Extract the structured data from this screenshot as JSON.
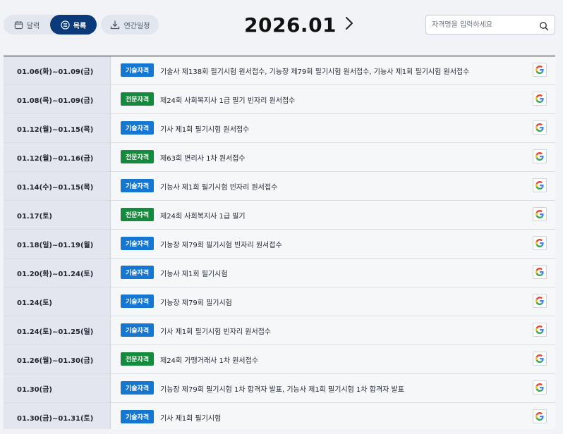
{
  "toolbar": {
    "calendar_label": "달력",
    "list_label": "목록",
    "yearly_label": "연간일정"
  },
  "header": {
    "month": "2026.01"
  },
  "search": {
    "placeholder": "자격명을 입력하세요",
    "value": ""
  },
  "colors": {
    "tech_badge": "#1677d2",
    "pro_badge": "#148a3c",
    "active_toggle": "#0b3a7a"
  },
  "rows": [
    {
      "date": "01.06(화)~01.09(금)",
      "badge": "기술자격",
      "kind": "tech",
      "title": "기술사 제138회 필기시험 원서접수, 기능장 제79회 필기시험 원서접수, 기능사 제1회 필기시험 원서접수",
      "action_icon": "google-g-icon"
    },
    {
      "date": "01.08(목)~01.09(금)",
      "badge": "전문자격",
      "kind": "pro",
      "title": "제24회 사회복지사 1급 필기 빈자리 원서접수",
      "action_icon": "google-g-icon"
    },
    {
      "date": "01.12(월)~01.15(목)",
      "badge": "기술자격",
      "kind": "tech",
      "title": "기사 제1회 필기시험 원서접수",
      "action_icon": "google-g-icon"
    },
    {
      "date": "01.12(월)~01.16(금)",
      "badge": "전문자격",
      "kind": "pro",
      "title": "제63회 변리사 1차 원서접수",
      "action_icon": "google-g-icon"
    },
    {
      "date": "01.14(수)~01.15(목)",
      "badge": "기술자격",
      "kind": "tech",
      "title": "기능사 제1회 필기시험 빈자리 원서접수",
      "action_icon": "google-g-icon"
    },
    {
      "date": "01.17(토)",
      "badge": "전문자격",
      "kind": "pro",
      "title": "제24회 사회복지사 1급 필기",
      "action_icon": "google-g-icon"
    },
    {
      "date": "01.18(일)~01.19(월)",
      "badge": "기술자격",
      "kind": "tech",
      "title": "기능장 제79회 필기시험 빈자리 원서접수",
      "action_icon": "google-g-icon"
    },
    {
      "date": "01.20(화)~01.24(토)",
      "badge": "기술자격",
      "kind": "tech",
      "title": "기능사 제1회 필기시험",
      "action_icon": "google-g-icon"
    },
    {
      "date": "01.24(토)",
      "badge": "기술자격",
      "kind": "tech",
      "title": "기능장 제79회 필기시험",
      "action_icon": "google-g-icon"
    },
    {
      "date": "01.24(토)~01.25(일)",
      "badge": "기술자격",
      "kind": "tech",
      "title": "기사 제1회 필기시험 빈자리 원서접수",
      "action_icon": "google-g-icon"
    },
    {
      "date": "01.26(월)~01.30(금)",
      "badge": "전문자격",
      "kind": "pro",
      "title": "제24회 가맹거래사 1차 원서접수",
      "action_icon": "google-g-icon"
    },
    {
      "date": "01.30(금)",
      "badge": "기술자격",
      "kind": "tech",
      "title": "기능장 제79회 필기시험 1차 합격자 발표, 기능사 제1회 필기시험 1차 합격자 발표",
      "action_icon": "google-g-icon"
    },
    {
      "date": "01.30(금)~01.31(토)",
      "badge": "기술자격",
      "kind": "tech",
      "title": "기사 제1회 필기시험",
      "action_icon": "google-g-icon"
    }
  ]
}
